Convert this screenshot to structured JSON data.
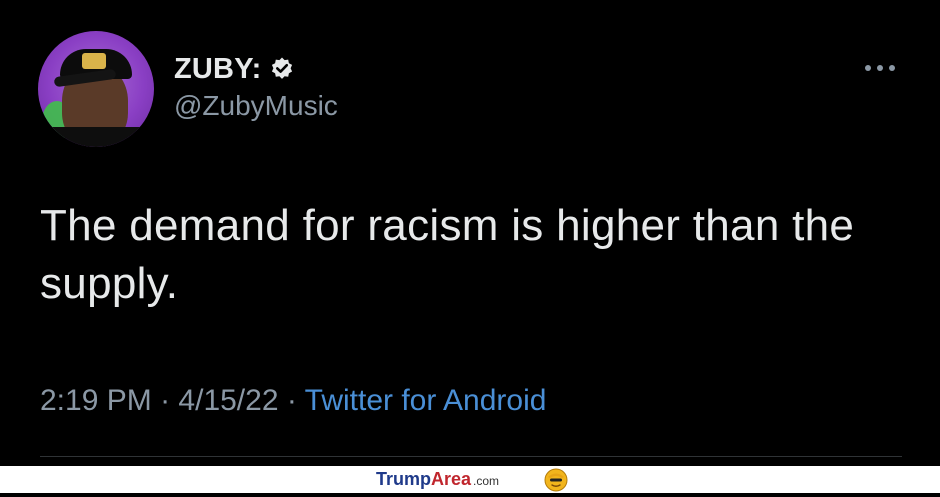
{
  "tweet": {
    "display_name": "ZUBY:",
    "handle": "@ZubyMusic",
    "text": "The demand for racism is higher than the supply.",
    "time": "2:19 PM",
    "separator1": "·",
    "date": "4/15/22",
    "separator2": "·",
    "source": "Twitter for Android"
  },
  "icons": {
    "verified": "verified-badge-icon",
    "more": "more-options-icon",
    "avatar": "profile-avatar"
  },
  "footer": {
    "brand_part1": "Trump",
    "brand_part2": "Area",
    "brand_suffix": ".com"
  },
  "colors": {
    "background": "#000000",
    "text": "#e7e9ea",
    "secondary_text": "#8b98a5",
    "link": "#4a8fd6",
    "avatar_ring": "#8a3fc4"
  }
}
